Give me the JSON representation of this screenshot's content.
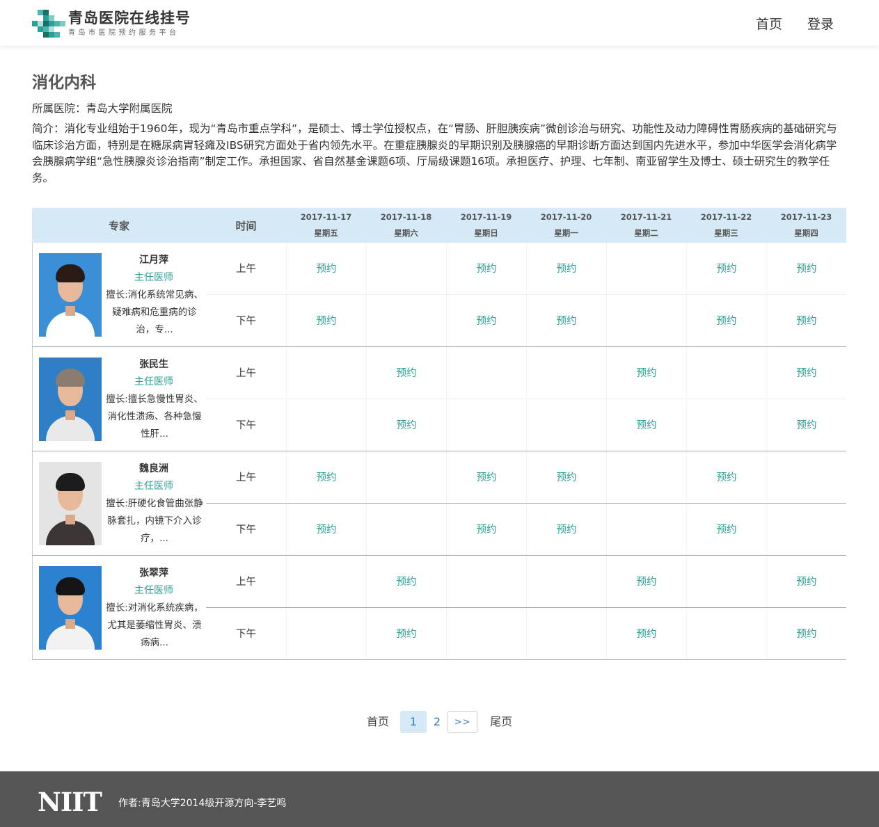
{
  "header": {
    "site_title": "青岛医院在线挂号",
    "site_subtitle": "青岛市医院预约服务平台",
    "logo_icon": "pixel-cross-logo",
    "accent_color": "#2aa198",
    "nav": [
      {
        "label": "首页"
      },
      {
        "label": "登录"
      }
    ]
  },
  "department": {
    "name": "消化内科",
    "hospital": "所属医院：青岛大学附属医院",
    "intro": "简介：消化专业组始于1960年，现为“青岛市重点学科”，是硕士、博士学位授权点，在“胃肠、肝胆胰疾病”微创诊治与研究、功能性及动力障碍性胃肠疾病的基础研究与临床诊治方面，特别是在糖尿病胃轻瘫及IBS研究方面处于省内领先水平。在重症胰腺炎的早期识别及胰腺癌的早期诊断方面达到国内先进水平，参加中华医学会消化病学会胰腺病学组“急性胰腺炎诊治指南”制定工作。承担国家、省自然基金课题6项、厅局级课题16项。承担医疗、护理、七年制、南亚留学生及博士、硕士研究生的教学任务。"
  },
  "schedule": {
    "header_color": "#d5eaf6",
    "col_doctor": "专家",
    "col_time": "时间",
    "days": [
      {
        "date": "2017-11-17",
        "weekday": "星期五"
      },
      {
        "date": "2017-11-18",
        "weekday": "星期六"
      },
      {
        "date": "2017-11-19",
        "weekday": "星期日"
      },
      {
        "date": "2017-11-20",
        "weekday": "星期一"
      },
      {
        "date": "2017-11-21",
        "weekday": "星期二"
      },
      {
        "date": "2017-11-22",
        "weekday": "星期三"
      },
      {
        "date": "2017-11-23",
        "weekday": "星期四"
      }
    ],
    "am_label": "上午",
    "pm_label": "下午",
    "book_label": "预约",
    "doctors": [
      {
        "name": "江月萍",
        "title": "主任医师",
        "skill": "擅长:消化系统常见病、疑难病和危重病的诊治，专...",
        "am": [
          true,
          false,
          true,
          true,
          false,
          true,
          true
        ],
        "pm": [
          true,
          false,
          true,
          true,
          false,
          true,
          true
        ]
      },
      {
        "name": "张民生",
        "title": "主任医师",
        "skill": "擅长:擅长急慢性胃炎、消化性溃疡、各种急慢性肝...",
        "am": [
          false,
          true,
          false,
          false,
          true,
          false,
          true
        ],
        "pm": [
          false,
          true,
          false,
          false,
          true,
          false,
          true
        ]
      },
      {
        "name": "魏良洲",
        "title": "主任医师",
        "skill": "擅长:肝硬化食管曲张静脉套扎，内镜下介入诊疗，...",
        "am": [
          true,
          false,
          true,
          true,
          false,
          true,
          false
        ],
        "pm": [
          true,
          false,
          true,
          true,
          false,
          true,
          false
        ]
      },
      {
        "name": "张翠萍",
        "title": "主任医师",
        "skill": "擅长:对消化系统疾病，尤其是萎缩性胃炎、溃疡病...",
        "am": [
          false,
          true,
          false,
          false,
          true,
          false,
          true
        ],
        "pm": [
          false,
          true,
          false,
          false,
          true,
          false,
          true
        ]
      }
    ]
  },
  "pagination": {
    "first": "首页",
    "pages": [
      "1",
      "2"
    ],
    "current": "1",
    "next": ">>",
    "last": "尾页"
  },
  "footer": {
    "logo_text": "NIIT",
    "author": "作者:青岛大学2014级开源方向-李艺鸣"
  }
}
